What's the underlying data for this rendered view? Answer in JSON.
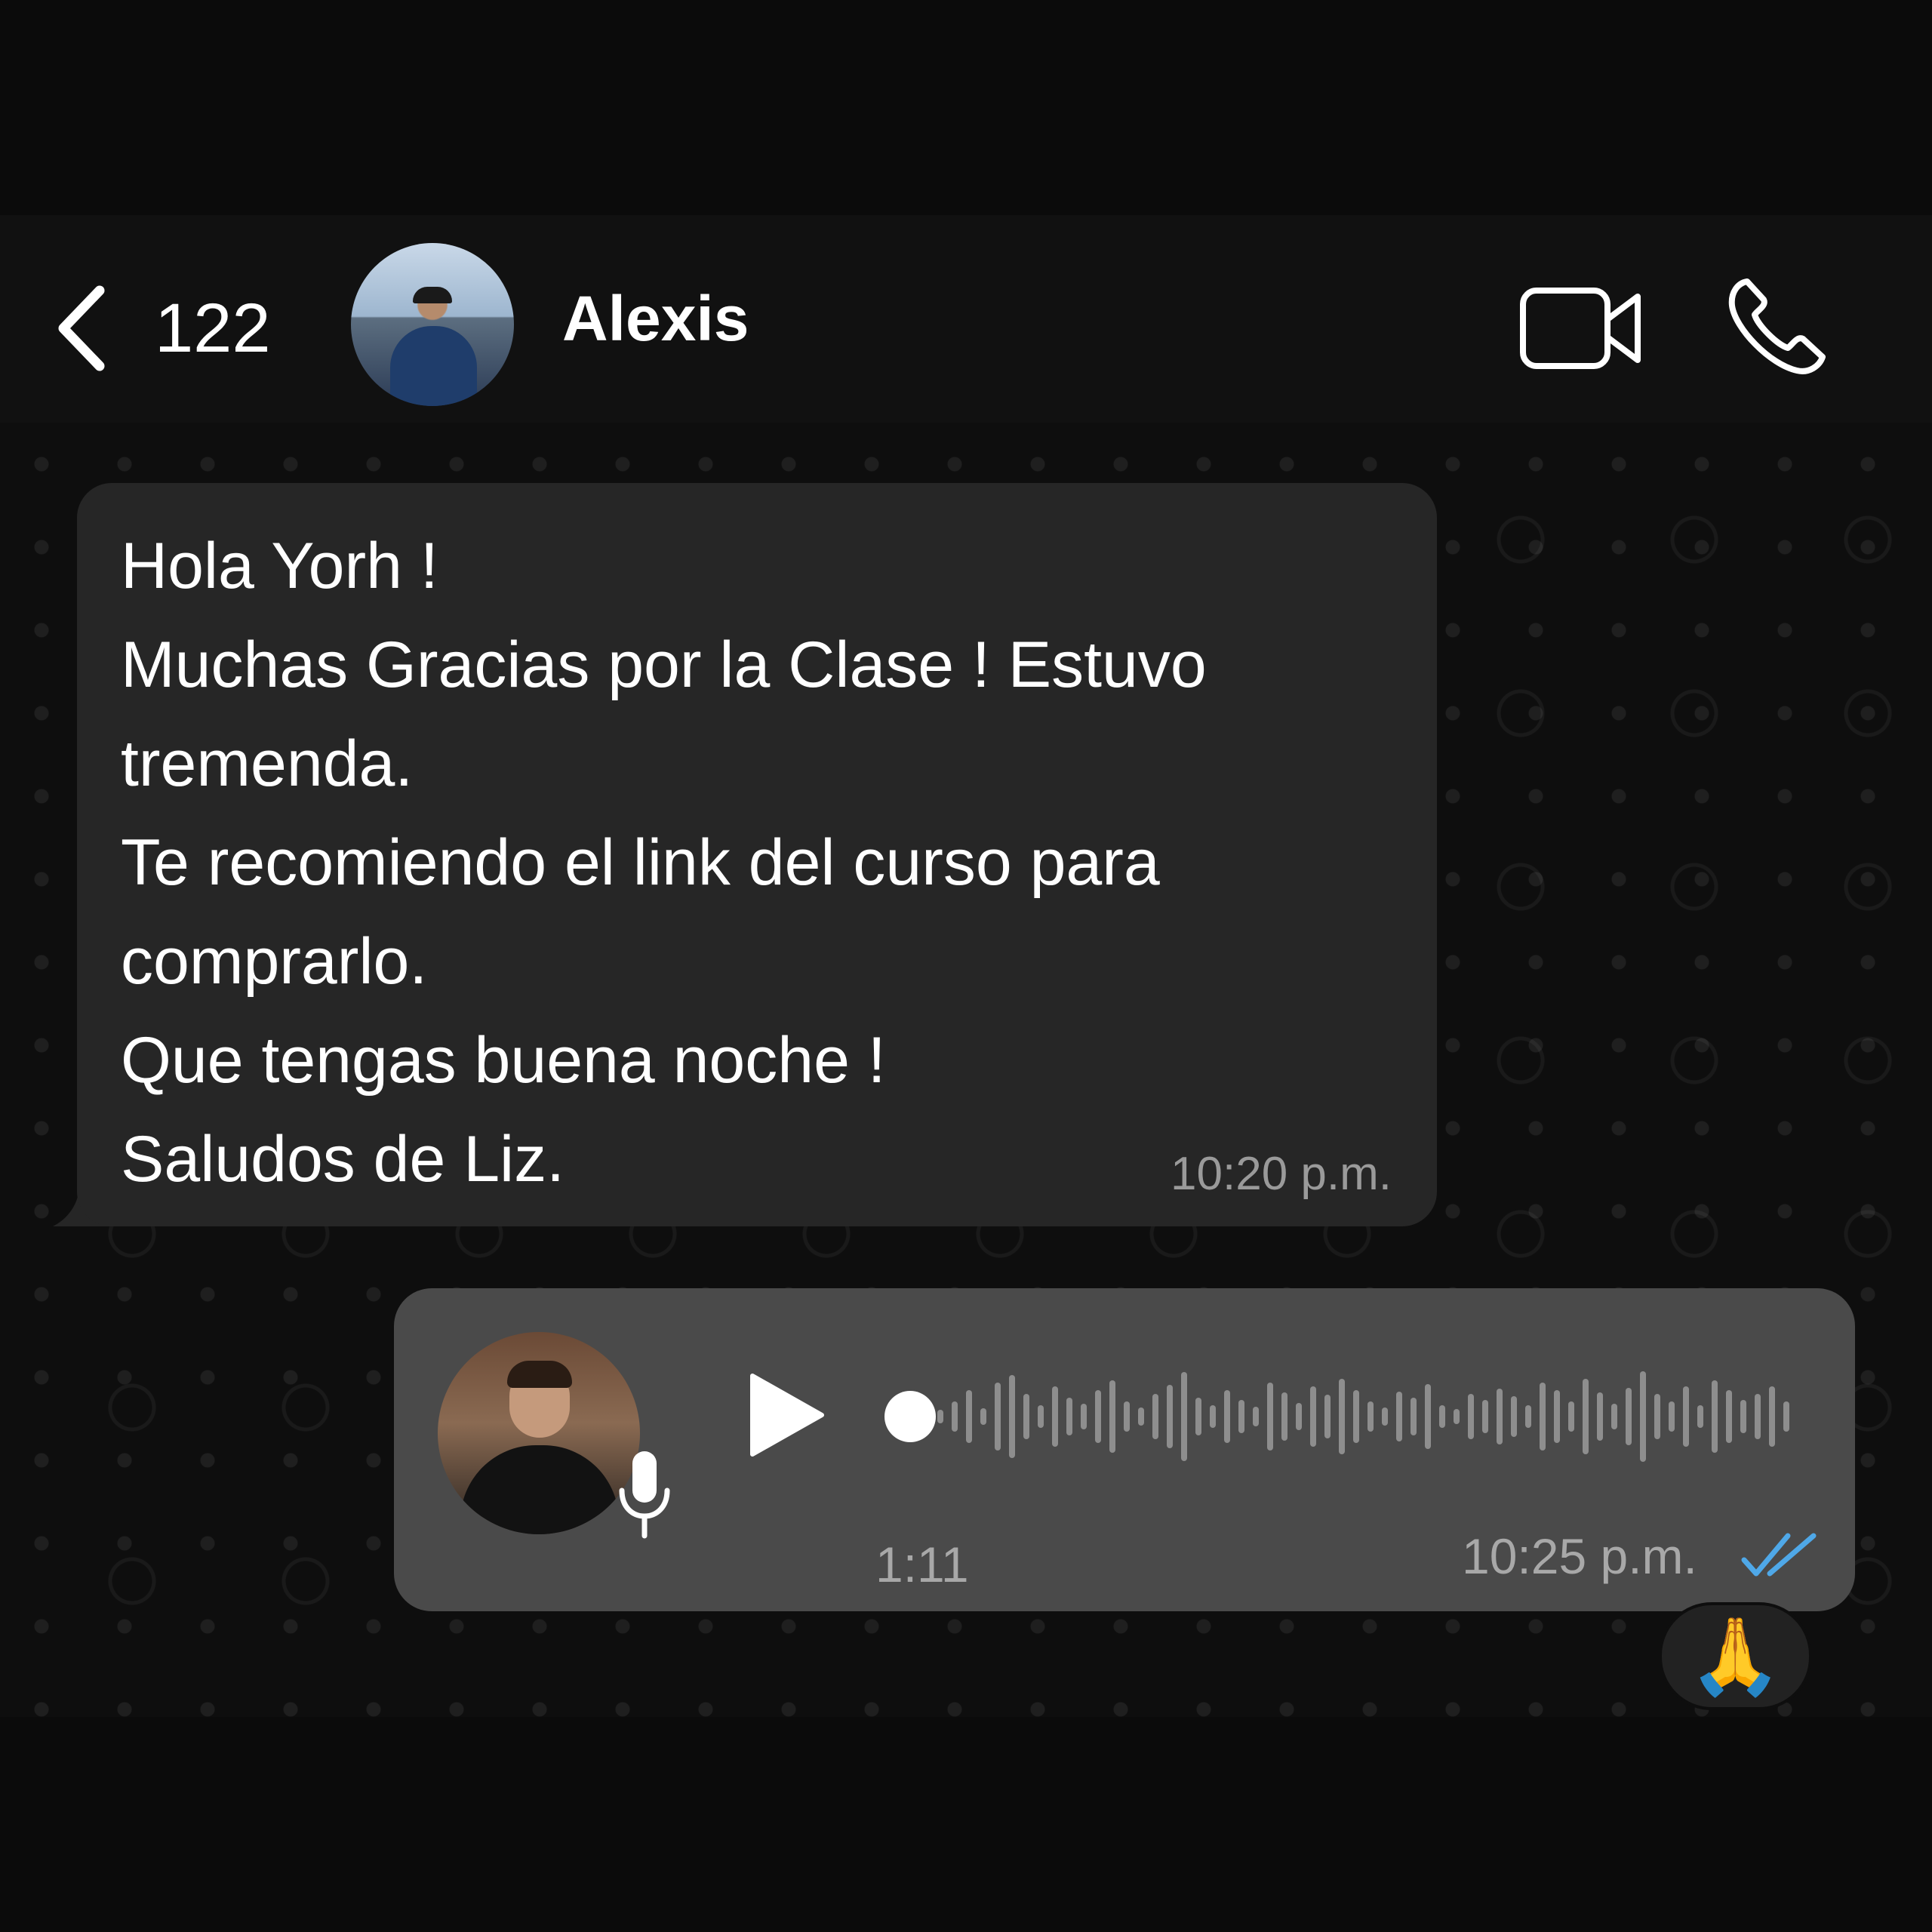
{
  "header": {
    "back_count": "122",
    "contact_name": "Alexis",
    "icons": [
      "chevron-left-icon",
      "video-camera-icon",
      "phone-icon"
    ]
  },
  "incoming_message": {
    "lines": [
      "Hola Yorh !",
      "Muchas Gracias por la Clase ! Estuvo",
      "tremenda.",
      "Te recomiendo el link del curso para",
      "comprarlo.",
      "Que tengas buena noche !",
      "Saludos de Liz."
    ],
    "time": "10:20 p.m."
  },
  "voice_message": {
    "duration": "1:11",
    "time": "10:25 p.m.",
    "playback_progress": 0,
    "status": "read",
    "icons": [
      "play-icon",
      "microphone-icon",
      "double-check-icon"
    ]
  },
  "reaction": {
    "emoji": "🙏"
  },
  "colors": {
    "background": "#0b0b0b",
    "header": "#111111",
    "incoming_bubble": "#262626",
    "outgoing_bubble": "#4a4a4a",
    "read_tick": "#4fa8e8",
    "muted_text": "#9a9a9a"
  }
}
